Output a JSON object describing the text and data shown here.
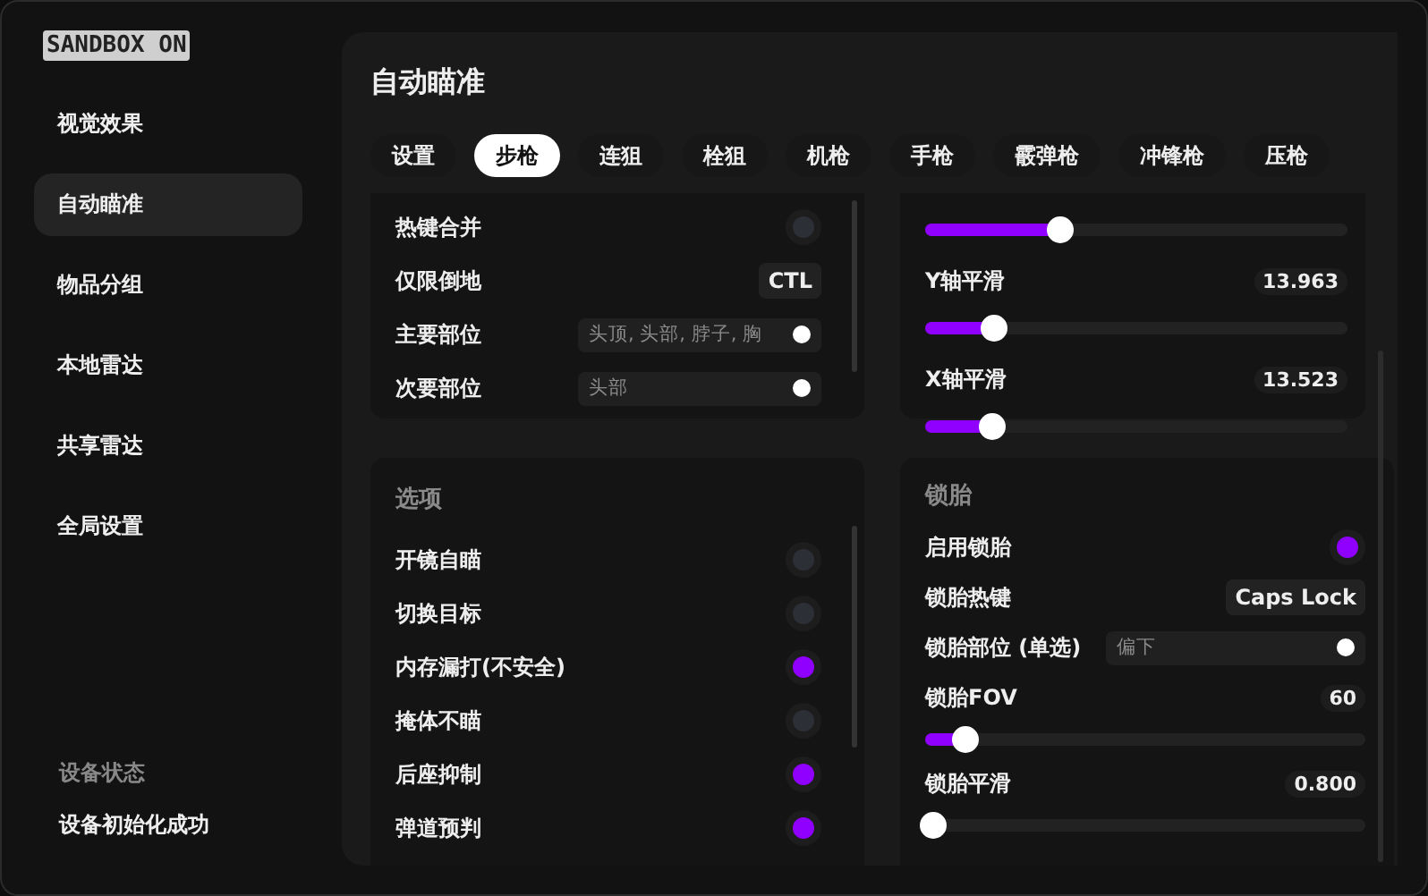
{
  "sidebar": {
    "logo": "SANDBOX ON",
    "items": [
      {
        "label": "视觉效果",
        "selected": false
      },
      {
        "label": "自动瞄准",
        "selected": true
      },
      {
        "label": "物品分组",
        "selected": false
      },
      {
        "label": "本地雷达",
        "selected": false
      },
      {
        "label": "共享雷达",
        "selected": false
      },
      {
        "label": "全局设置",
        "selected": false
      }
    ],
    "status": {
      "title": "设备状态",
      "text": "设备初始化成功"
    }
  },
  "page_title": "自动瞄准",
  "tabs": [
    {
      "label": "设置",
      "selected": false
    },
    {
      "label": "步枪",
      "selected": true
    },
    {
      "label": "连狙",
      "selected": false
    },
    {
      "label": "栓狙",
      "selected": false
    },
    {
      "label": "机枪",
      "selected": false
    },
    {
      "label": "手枪",
      "selected": false
    },
    {
      "label": "霰弹枪",
      "selected": false
    },
    {
      "label": "冲锋枪",
      "selected": false
    },
    {
      "label": "压枪",
      "selected": false
    }
  ],
  "panels": [
    {
      "rows": [
        {
          "kind": "toggle",
          "label": "热键合并",
          "on": false
        },
        {
          "kind": "key",
          "label": "仅限倒地",
          "value": "CTL"
        },
        {
          "kind": "select",
          "label": "主要部位",
          "value": "头顶, 头部, 脖子, 胸"
        },
        {
          "kind": "select",
          "label": "次要部位",
          "value": "头部"
        }
      ]
    },
    {
      "rows": [
        {
          "kind": "slider",
          "level": 0.32
        },
        {
          "kind": "slider",
          "label": "Y轴平滑",
          "value": "13.963",
          "level": 0.165
        },
        {
          "kind": "slider",
          "label": "X轴平滑",
          "value": "13.523",
          "level": 0.16
        }
      ]
    },
    {
      "title": "选项",
      "rows": [
        {
          "kind": "toggle",
          "label": "开镜自瞄",
          "on": false
        },
        {
          "kind": "toggle",
          "label": "切换目标",
          "on": false
        },
        {
          "kind": "toggle",
          "label": "内存漏打(不安全)",
          "on": true
        },
        {
          "kind": "toggle",
          "label": "掩体不瞄",
          "on": false
        },
        {
          "kind": "toggle",
          "label": "后座抑制",
          "on": true
        },
        {
          "kind": "toggle",
          "label": "弹道预判",
          "on": true
        }
      ]
    },
    {
      "title": "锁胎",
      "rows": [
        {
          "kind": "toggle",
          "label": "启用锁胎",
          "on": true
        },
        {
          "kind": "key",
          "label": "锁胎热键",
          "value": "Caps Lock"
        },
        {
          "kind": "select",
          "label": "锁胎部位 (单选)",
          "value": "偏下"
        },
        {
          "kind": "slider",
          "label": "锁胎FOV",
          "value": "60",
          "level": 0.09
        },
        {
          "kind": "slider",
          "label": "锁胎平滑",
          "value": "0.800",
          "level": 0.02
        }
      ]
    }
  ]
}
